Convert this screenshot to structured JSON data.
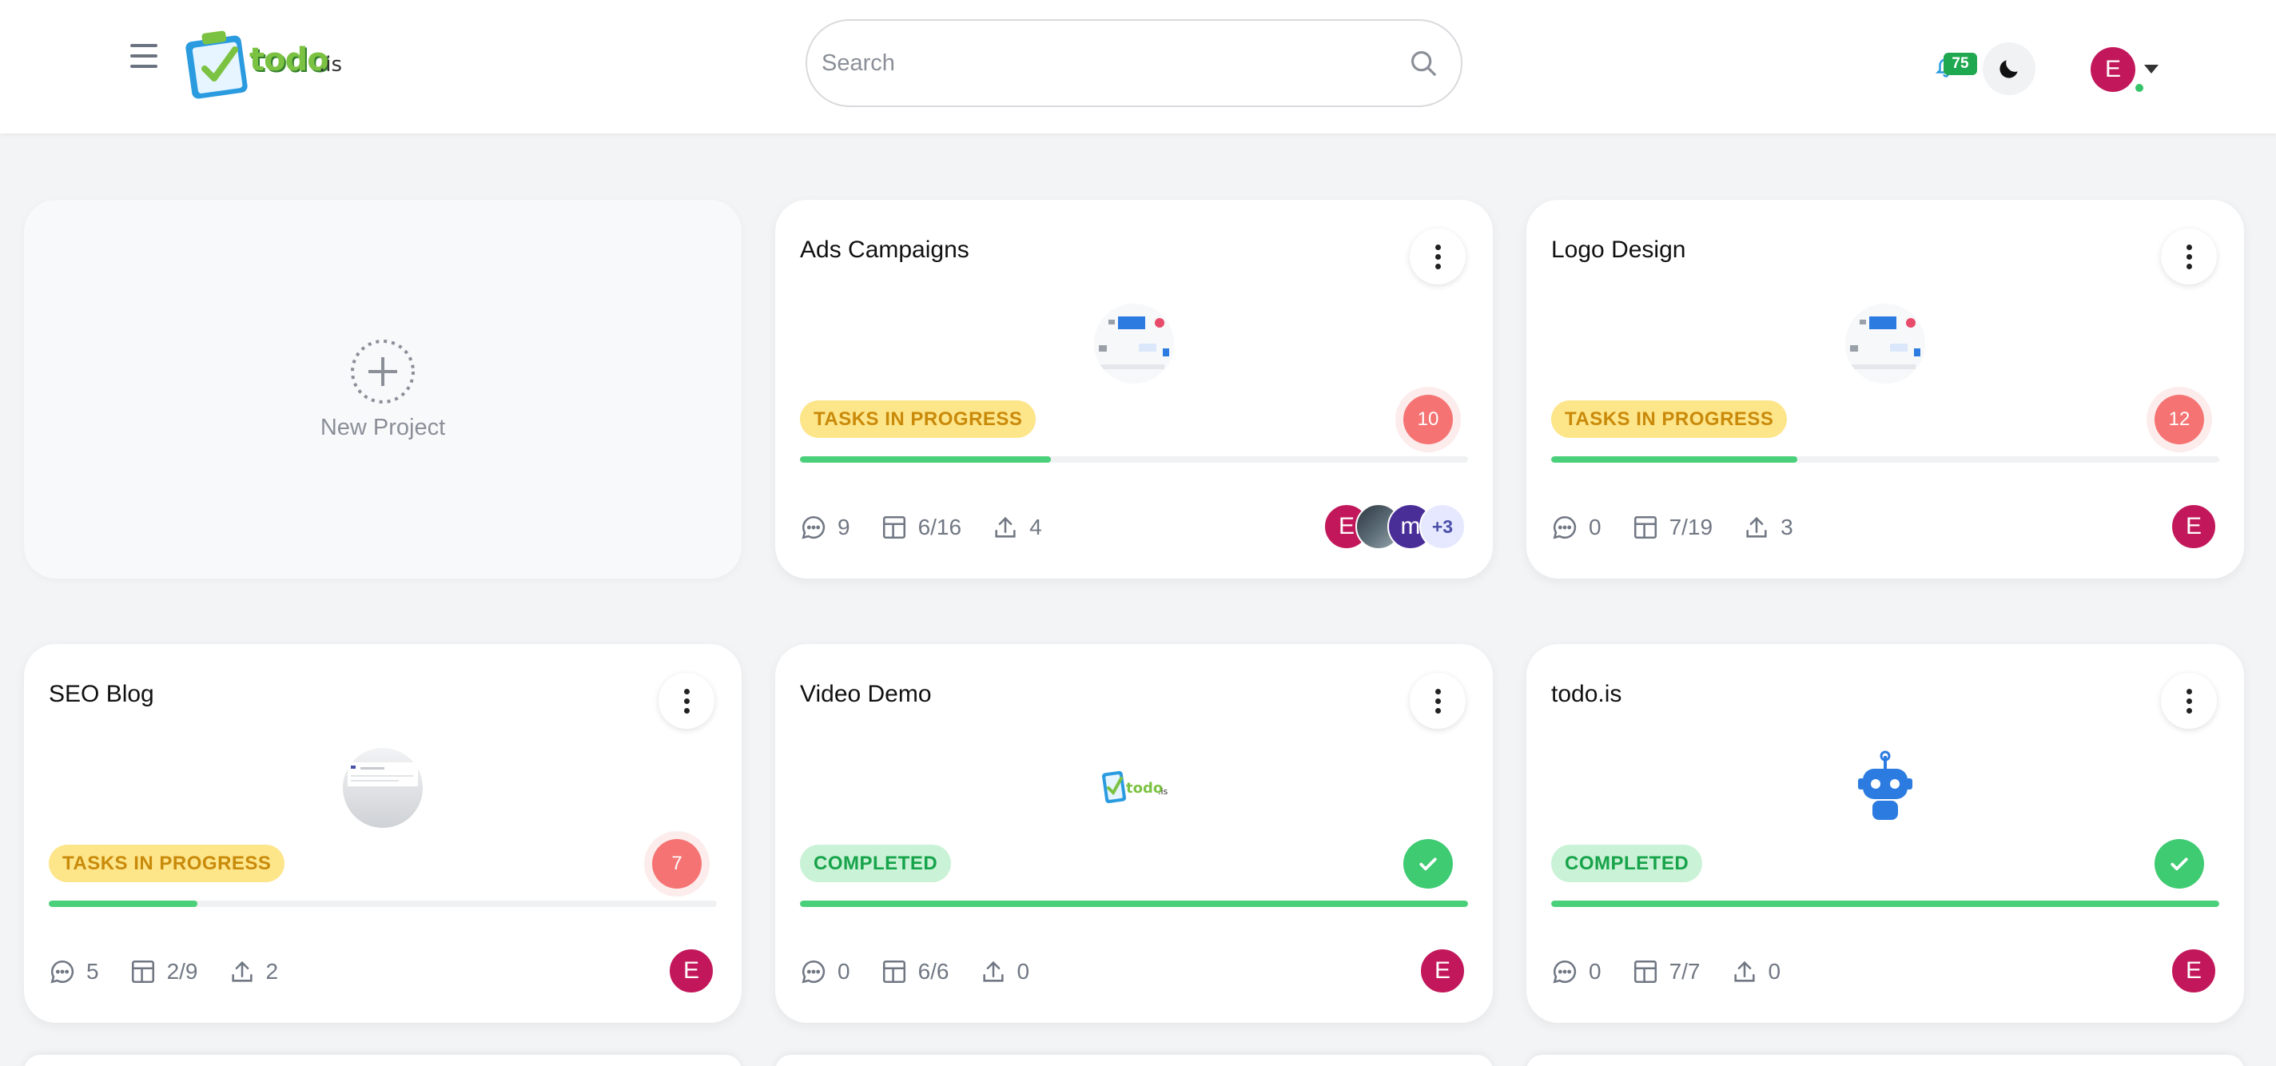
{
  "header": {
    "logo_text": "todo",
    "logo_suffix": ".is",
    "search_placeholder": "Search",
    "notification_count": "75",
    "user_initial": "E"
  },
  "new_project": {
    "label": "New Project"
  },
  "projects": [
    {
      "title": "Ads Campaigns",
      "status": "TASKS IN PROGRESS",
      "open_count": "10",
      "progress": 0.375,
      "comments": "9",
      "tasks": "6/16",
      "uploads": "4",
      "members": [
        "E",
        "",
        "m",
        "+3"
      ]
    },
    {
      "title": "Logo Design",
      "status": "TASKS IN PROGRESS",
      "open_count": "12",
      "progress": 0.368,
      "comments": "0",
      "tasks": "7/19",
      "uploads": "3",
      "members": [
        "E"
      ]
    },
    {
      "title": "SEO Blog",
      "status": "TASKS IN PROGRESS",
      "open_count": "7",
      "progress": 0.222,
      "comments": "5",
      "tasks": "2/9",
      "uploads": "2",
      "members": [
        "E"
      ]
    },
    {
      "title": "Video Demo",
      "status": "COMPLETED",
      "progress": 1.0,
      "comments": "0",
      "tasks": "6/6",
      "uploads": "0",
      "members": [
        "E"
      ]
    },
    {
      "title": "todo.is",
      "status": "COMPLETED",
      "progress": 1.0,
      "comments": "0",
      "tasks": "7/7",
      "uploads": "0",
      "members": [
        "E"
      ]
    }
  ],
  "colors": {
    "accent_green": "#4ad07a",
    "in_progress_bg": "#fde58a",
    "completed_bg": "#c9f2d6",
    "badge_red": "#f57373",
    "avatar_magenta": "#c2185b"
  }
}
